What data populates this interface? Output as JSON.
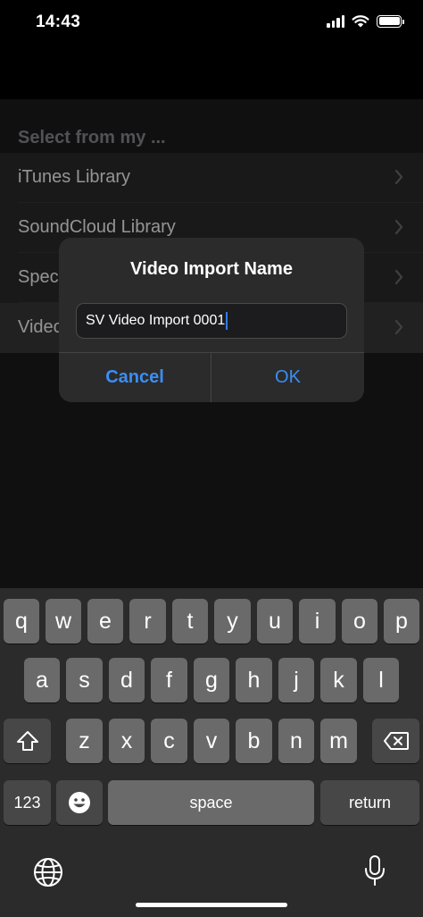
{
  "status": {
    "time": "14:43"
  },
  "list": {
    "header": "Select from my ...",
    "rows": [
      "iTunes Library",
      "SoundCloud Library",
      "Spec",
      "Video"
    ]
  },
  "alert": {
    "title": "Video Import Name",
    "input_value": "SV Video Import 0001",
    "cancel_label": "Cancel",
    "ok_label": "OK"
  },
  "keyboard": {
    "row1": [
      "q",
      "w",
      "e",
      "r",
      "t",
      "y",
      "u",
      "i",
      "o",
      "p"
    ],
    "row2": [
      "a",
      "s",
      "d",
      "f",
      "g",
      "h",
      "j",
      "k",
      "l"
    ],
    "row3": [
      "z",
      "x",
      "c",
      "v",
      "b",
      "n",
      "m"
    ],
    "numbers_label": "123",
    "space_label": "space",
    "return_label": "return",
    "icons": [
      "shift-icon",
      "backspace-icon",
      "emoji-icon",
      "globe-icon",
      "microphone-icon"
    ]
  },
  "colors": {
    "accent": "#3a8ef6",
    "caret": "#3478f6"
  }
}
